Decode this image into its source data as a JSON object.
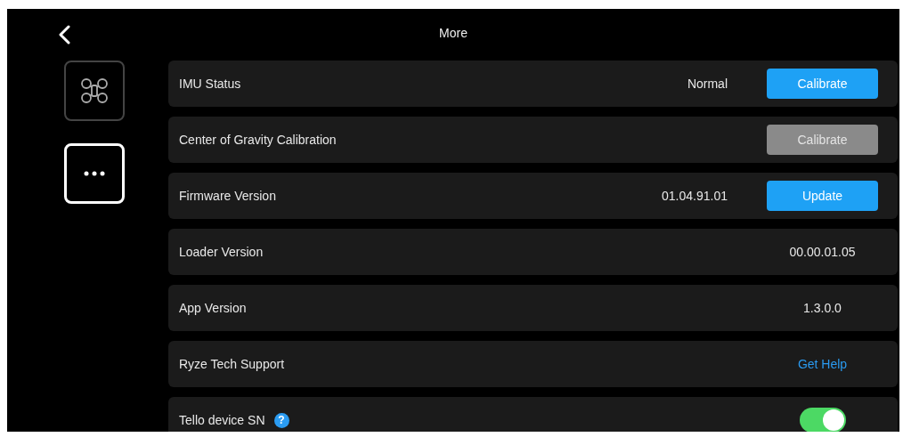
{
  "header": {
    "title": "More"
  },
  "sidebar": {
    "items": [
      {
        "kind": "drone",
        "selected": false
      },
      {
        "kind": "more",
        "selected": true
      }
    ]
  },
  "rows": [
    {
      "kind": "button",
      "label": "IMU Status",
      "value": "Normal",
      "button": {
        "label": "Calibrate",
        "disabled": false
      }
    },
    {
      "kind": "button",
      "label": "Center of Gravity Calibration",
      "button": {
        "label": "Calibrate",
        "disabled": true
      }
    },
    {
      "kind": "button",
      "label": "Firmware Version",
      "value": "01.04.91.01",
      "button": {
        "label": "Update",
        "disabled": false
      }
    },
    {
      "kind": "value",
      "label": "Loader Version",
      "value": "00.00.01.05"
    },
    {
      "kind": "value",
      "label": "App Version",
      "value": "1.3.0.0"
    },
    {
      "kind": "link",
      "label": "Ryze Tech Support",
      "link": "Get Help"
    },
    {
      "kind": "toggle",
      "label": "Tello device SN",
      "help": "?",
      "on": true
    }
  ]
}
